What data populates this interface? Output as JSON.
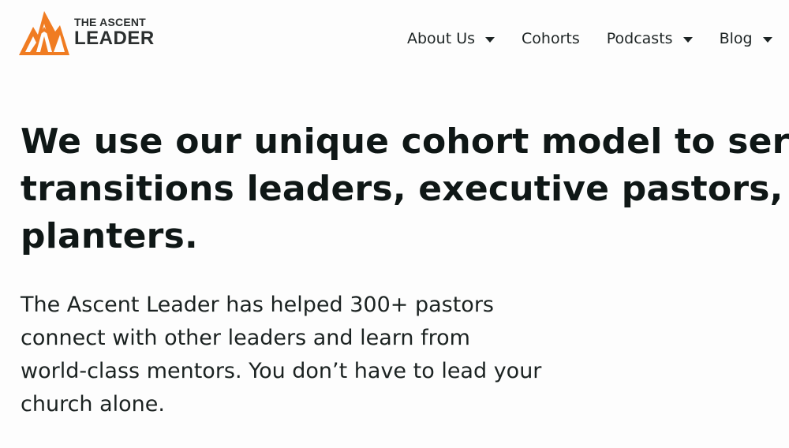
{
  "header": {
    "logo": {
      "line1": "THE ASCENT",
      "line2": "LEADER",
      "brand_color": "#f07c22",
      "icon": "mountain-logo-icon"
    },
    "nav": [
      {
        "label": "About Us",
        "has_dropdown": true
      },
      {
        "label": "Cohorts",
        "has_dropdown": false
      },
      {
        "label": "Podcasts",
        "has_dropdown": true
      },
      {
        "label": "Blog",
        "has_dropdown": true
      }
    ]
  },
  "hero": {
    "heading_lines": [
      "We use our unique cohort model to serve",
      "transitions leaders, executive pastors, and",
      "planters."
    ],
    "body_lines": [
      "The Ascent Leader has helped 300+ pastors",
      "connect with other leaders and learn from",
      "world-class mentors. You don’t have to lead your",
      "church alone."
    ]
  },
  "colors": {
    "background": "#fdfdfd",
    "text": "#0f1716",
    "accent": "#f07c22"
  }
}
